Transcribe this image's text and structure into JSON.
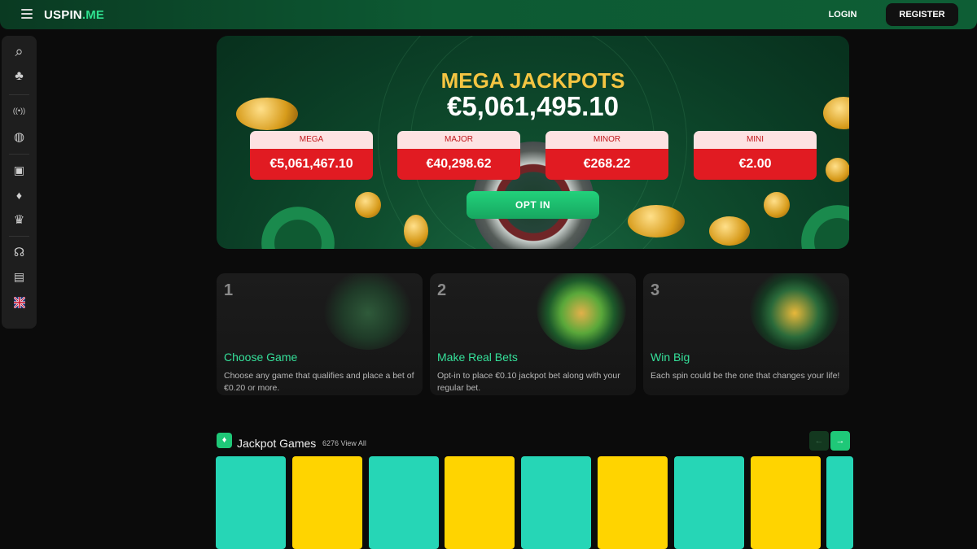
{
  "header": {
    "logo_part1": "USPIN",
    "logo_part2": ".ME",
    "login_label": "LOGIN",
    "register_label": "REGISTER",
    "accent": "#2fe08f"
  },
  "sidebar": {
    "items": [
      {
        "icon": "search-icon",
        "glyph": "⌕"
      },
      {
        "icon": "club-icon",
        "glyph": "♣"
      },
      {
        "icon": "live-icon",
        "glyph": "((•))"
      },
      {
        "icon": "basketball-icon",
        "glyph": "◍"
      },
      {
        "icon": "gift-icon",
        "glyph": "▣"
      },
      {
        "icon": "money-bag-icon",
        "glyph": "♦"
      },
      {
        "icon": "crown-icon",
        "glyph": "♛"
      },
      {
        "icon": "headset-icon",
        "glyph": "☊"
      },
      {
        "icon": "wallet-icon",
        "glyph": "▤"
      },
      {
        "icon": "uk-flag-icon",
        "glyph": "✚"
      }
    ]
  },
  "hero": {
    "title": "MEGA JACKPOTS",
    "amount": "€5,061,495.10",
    "tiers": [
      {
        "label": "MEGA",
        "value": "€5,061,467.10"
      },
      {
        "label": "MAJOR",
        "value": "€40,298.62"
      },
      {
        "label": "MINOR",
        "value": "€268.22"
      },
      {
        "label": "MINI",
        "value": "€2.00"
      }
    ],
    "opt_in_label": "OPT IN"
  },
  "steps": [
    {
      "num": "1",
      "title": "Choose Game",
      "desc": "Choose any game that qualifies and place a bet of €0.20 or more."
    },
    {
      "num": "2",
      "title": "Make Real Bets",
      "desc": "Opt-in to place €0.10 jackpot bet along with your regular bet."
    },
    {
      "num": "3",
      "title": "Win Big",
      "desc": "Each spin could be the one that changes your life!"
    }
  ],
  "jackpot_games": {
    "title": "Jackpot Games",
    "count_text": "6276 View All",
    "prev_icon": "arrow-left-icon",
    "next_icon": "arrow-right-icon",
    "tile_colors": [
      "#26d6b6",
      "#ffd400",
      "#26d6b6",
      "#ffd400",
      "#26d6b6",
      "#ffd400",
      "#26d6b6",
      "#ffd400",
      "#26d6b6"
    ]
  }
}
